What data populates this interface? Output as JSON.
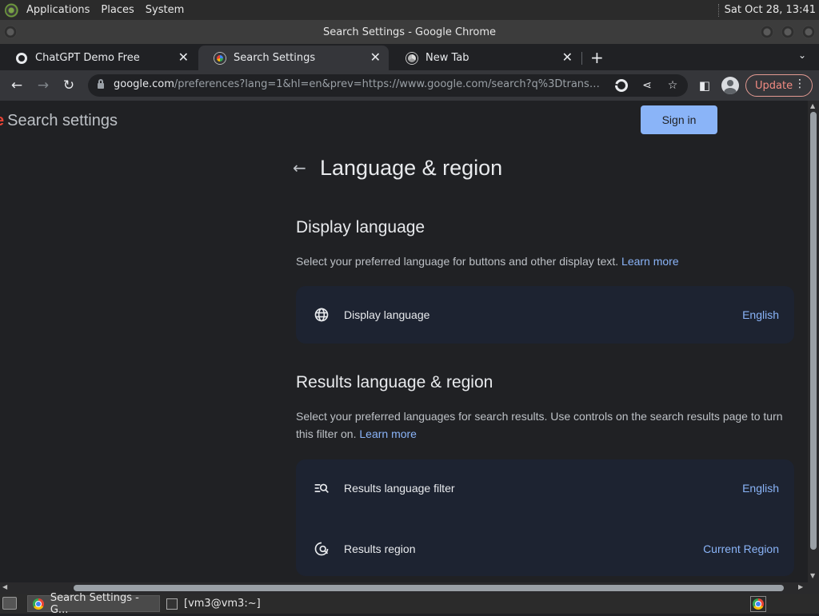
{
  "top_panel": {
    "menus": [
      "Applications",
      "Places",
      "System"
    ],
    "clock": "Sat Oct 28, 13:41"
  },
  "window": {
    "title": "Search Settings - Google Chrome"
  },
  "tabs": [
    {
      "label": "ChatGPT Demo Free"
    },
    {
      "label": "Search Settings"
    },
    {
      "label": "New Tab"
    }
  ],
  "toolbar": {
    "url_host": "google.com",
    "url_rest": "/preferences?lang=1&hl=en&prev=https://www.google.com/search?q%3Dtransform...",
    "update_label": "Update"
  },
  "page": {
    "header_title": "Search settings",
    "sign_in_label": "Sign in",
    "title": "Language & region",
    "display_section": {
      "title": "Display language",
      "description": "Select your preferred language for buttons and other display text.",
      "learn_more": "Learn more",
      "row": {
        "label": "Display language",
        "value": "English"
      }
    },
    "results_section": {
      "title": "Results language & region",
      "description": "Select your preferred languages for search results. Use controls on the search results page to turn this filter on.",
      "learn_more": "Learn more",
      "rows": [
        {
          "label": "Results language filter",
          "value": "English"
        },
        {
          "label": "Results region",
          "value": "Current Region"
        }
      ]
    }
  },
  "taskbar": {
    "tasks": [
      {
        "label": "Search Settings - G..."
      },
      {
        "label": "[vm3@vm3:~]"
      }
    ]
  },
  "icons": {
    "globe": "globe-icon",
    "filter": "results-filter-icon",
    "region": "region-search-icon"
  }
}
